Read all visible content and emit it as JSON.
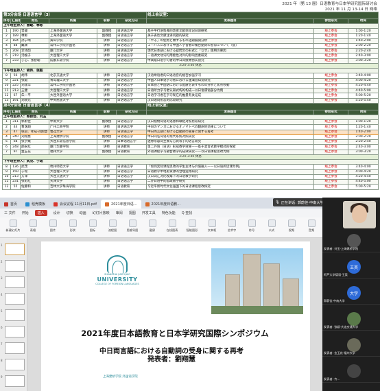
{
  "header": {
    "line1": "2021 年（第 13 届）日语教育与日本学研究国际研讨会",
    "line2": "2021 年 11 月 13-14 日 网络"
  },
  "sessions": [
    {
      "title": "第3分会场 日语语言学（3）",
      "zoom": "线上会议室：",
      "cols": [
        "序号",
        "汇报者",
        "姓名",
        "所属",
        "职称",
        "研究方向",
        "发表题目",
        "参会形式",
        "时间"
      ],
      "groups": [
        {
          "label": "上午场主持人：曾峻、林彬",
          "rows": [
            [
              "1",
              "190",
              "曾峻",
              "上海外国语大学",
              "副教授",
              "日语语言学",
              "基于平行语料库的改变文献体标记日译研究",
              "线上参会",
              "1:00-1:20"
            ],
            [
              "2",
              "189",
              "林彬",
              "上海外国语大学",
              "副教授",
              "日语语言学",
              "关于表达文献注译问题的研究",
              "线上参会",
              "1:20-1:40"
            ],
            [
              "3",
              "184",
              "孙宁晴",
              "黄山学院",
              "讲师",
              "日语语言学",
              "「やる」の使用と類するもの話題展開分析",
              "线上参会",
              "1:40-2:00"
            ],
            [
              "4",
              "88",
              "戴颖",
              "常州工学院外国语",
              "讲师",
              "日语语言学",
              "コーパスにおける中国人学習者の複合動詞の習得について（仮）",
              "线上参会",
              "2:00-2:20"
            ],
            [
              "5",
              "208",
              "李诗韵",
              "厦门大学",
              "讲师",
              "日语语言学",
              "現代日本語における疑問文の形式と「なぜ」使用の要因",
              "线上参会",
              "2:20-2:40"
            ],
            [
              "6",
              "219",
              "汤嫂子",
              "大连理工大学",
              "讲师",
              "日语语言学",
              "二语课文动词可用能性对外的影响因素研究",
              "线上参会",
              "2:40-3:00"
            ],
            [
              "7",
              "233",
              "于心、张智聪",
              "成都东软学院",
              "讲师",
              "日语语言学",
              "中高级日语学习者的中日间接致仿实验究",
              "线上参会",
              "3:00-3:20"
            ]
          ],
          "break": "3:20-3:40 休息"
        },
        {
          "label": "下午场主持人：胡伟、张毅",
          "rows": [
            [
              "8",
              "56",
              "胡伟",
              "北京交通大学",
              "讲师",
              "日语语言学",
              "汉语母语者的日语语音的能否加强学习",
              "线上参会",
              "3:40-4:00"
            ],
            [
              "9",
              "221",
              "张毅",
              "青岛理工大学",
              "讲师",
              "日语语言学",
              "中国人日本语学习者における連濁音知覚研究",
              "线上参会",
              "4:00-4:20"
            ],
            [
              "10",
              "225",
              "刘建华",
              "常州工学院外国语",
              "讲师",
              "日语语言学",
              "日本語と中国語における配慮を表すものの分析と焦点移動",
              "线上参会",
              "4:20-4:40"
            ],
            [
              "11",
              "213",
              "王健",
              "大连理工大学",
              "讲师",
              "日语语言学",
              "日语听力学习者认知式构的构成一以日语谓语部分为例",
              "线上参会",
              "4:40-5:00"
            ],
            [
              "12",
              "67",
              "朱一平",
              "大连外国语大学",
              "讲师",
              "日语语言学",
              "日语学习者在学习现在的推量有关证成",
              "线上参会",
              "5:00-5:20"
            ],
            [
              "13",
              "191",
              "刘晓元",
              "中央民族大学",
              "讲师",
              "日语语言学",
              "汉日语词形态的比较研究",
              "线上参会",
              "5:20-5:40"
            ]
          ],
          "break": ""
        }
      ]
    },
    {
      "title": "第4分会场 日语语言学（4）",
      "zoom": "线上会议室：",
      "cols": [
        "序号",
        "汇报者",
        "姓名",
        "所属",
        "职称",
        "研究方向",
        "发表题目",
        "参会形式",
        "时间"
      ],
      "groups": [
        {
          "label": "上午场主持人：郭蔚佳、刘玉",
          "rows": [
            [
              "1",
              "311",
              "郭蔚佳",
              "中南大学",
              "副教授",
              "日语语言学",
              "汉日指物词语的语意和联结对照比较研究",
              "线上参会",
              "1:00-1:20"
            ],
            [
              "2",
              "44",
              "曹逸翔",
              "广州工商学院",
              "讲师",
              "日语语言学",
              "中日のマンガにおけるオノマトペの翻訳的効果について",
              "线上参会",
              "1:20-1:40"
            ],
            [
              "3",
              "47",
              "张良、孝成·刘翔慧",
              "鲁迅大学",
              "讲师",
              "日语语言学",
              "中日両言語における自動詞の受身に関する再考",
              "线上参会",
              "1:40-2:00"
            ],
            [
              "4",
              "240",
              "刘翔慧",
              "上海建桥学院",
              "副教授",
              "日语语言学",
              "中日同名词语的现代系统对照研究",
              "线上参会",
              "2:00-2:20"
            ],
            [
              "5",
              "68",
              "张学斌",
              "大连东软信息学院",
              "讲师",
              "日本语语言学",
              "迷你形容词主要与方式等于的语言研究",
              "线上参会",
              "2:20-2:40"
            ],
            [
              "6",
              "248",
              "颜永红",
              "厦门华厦学院",
              "讲师",
              "日语教育",
              "第二外语（日语）形成教学效果——基于混合式教学模式的探索",
              "线上参会",
              "2:40-3:00"
            ],
            [
              "7",
              "97",
              "金玉花",
              "福州大学",
              "副教授",
              "日语教育",
              "外语课程学习融合教学的成效研究——以日语课程思政为例",
              "线上参会",
              "3:00-3:20"
            ]
          ],
          "break": "3:20-3:40 休息"
        },
        {
          "label": "下午场主持人：武茂、于瑶",
          "rows": [
            [
              "8",
              "136",
              "武茂",
              "杭州师范大学",
              "讲师",
              "日语语言学",
              "「如何実际课程思政的学生主体与价值融入——以日语阅读课为例」",
              "线上参会",
              "3:40-4:00"
            ],
            [
              "9",
              "150",
              "于瑶",
              "大连理工大学",
              "讲师",
              "日语语言学",
              "日语教学中电影资源的合理运用研究",
              "线上参会",
              "4:00-4:20"
            ],
            [
              "10",
              "213",
              "方萍",
              "大连交通大学",
              "讲师",
              "日语语言学",
              "汉日词汇对比视角下的日语教学研究",
              "线上参会",
              "4:20-4:40"
            ],
            [
              "11",
              "231",
              "张彩红",
              "天津大学",
              "讲师",
              "日语语言学",
              "二外日语中的思政教学研究",
              "线上参会",
              "4:40-5:00"
            ],
            [
              "12",
              "55",
              "佐藤和",
              "吉林大学珠海学院",
              "讲师",
              "日语教育",
              "习近平新时代文化强国下的日语课程思政探究",
              "线上参会",
              "5:00-5:20"
            ]
          ],
          "break": ""
        }
      ]
    }
  ],
  "app": {
    "tabs": [
      {
        "label": "首页",
        "color": "#c7352a"
      },
      {
        "label": "稻壳模板",
        "color": "#2b8fd0"
      },
      {
        "label": "会议议程 11月11日.pdf",
        "color": "#d9342b"
      },
      {
        "label": "2021年度日语...",
        "color": "#d86a2a"
      },
      {
        "label": "2021年度日语教...",
        "color": "#d86a2a"
      }
    ],
    "presenter": "正在讲话: 郭蔚佳·中南大学",
    "menu": [
      "三 文件",
      "开始",
      "插入",
      "设计",
      "切换",
      "动画",
      "幻灯片放映",
      "审阅",
      "视图",
      "开发工具",
      "特色功能",
      "Q 查找"
    ],
    "active_menu": "插入",
    "ribbon": [
      "新建幻灯片",
      "表格",
      "图片",
      "形状",
      "图标",
      "流程图",
      "思维导图",
      "截屏",
      "在线图表",
      "智能图形",
      "文本框",
      "艺术字",
      "符号",
      "公式",
      "视频",
      "音频"
    ],
    "slide": {
      "uni_line1": "SHANGHAI JIAN QIAO",
      "uni_line2": "UNIVERSITY",
      "uni_sub": "COLLEGE OF FOREIGN LANGUAGES",
      "title": "2021年度日本語教育と日本学研究国際シンポジウム",
      "subtitle1": "中日両言語における自動詞の受身に関する再考",
      "subtitle2": "発表者：劉翔慧",
      "footer": "上海建桥学院 外国语学院"
    },
    "participants": [
      {
        "name": "发表者: 刘玉·上海建桥学院",
        "initial": "",
        "color": "#555"
      },
      {
        "name": "阿芦大学德语·王英",
        "initial": "王英",
        "color": "#2e6bd8"
      },
      {
        "name": "郭蔚佳·中南大学",
        "initial": "大学",
        "color": "#2e6bd8"
      },
      {
        "name": "发表者: 张颖·大连交通大学",
        "initial": "",
        "color": "#5a7a4a"
      },
      {
        "name": "发表者: 金玉花·福州大学",
        "initial": "",
        "color": "#6a6a5a"
      },
      {
        "name": "发表者: 齐...",
        "initial": "",
        "color": "#444"
      }
    ]
  }
}
